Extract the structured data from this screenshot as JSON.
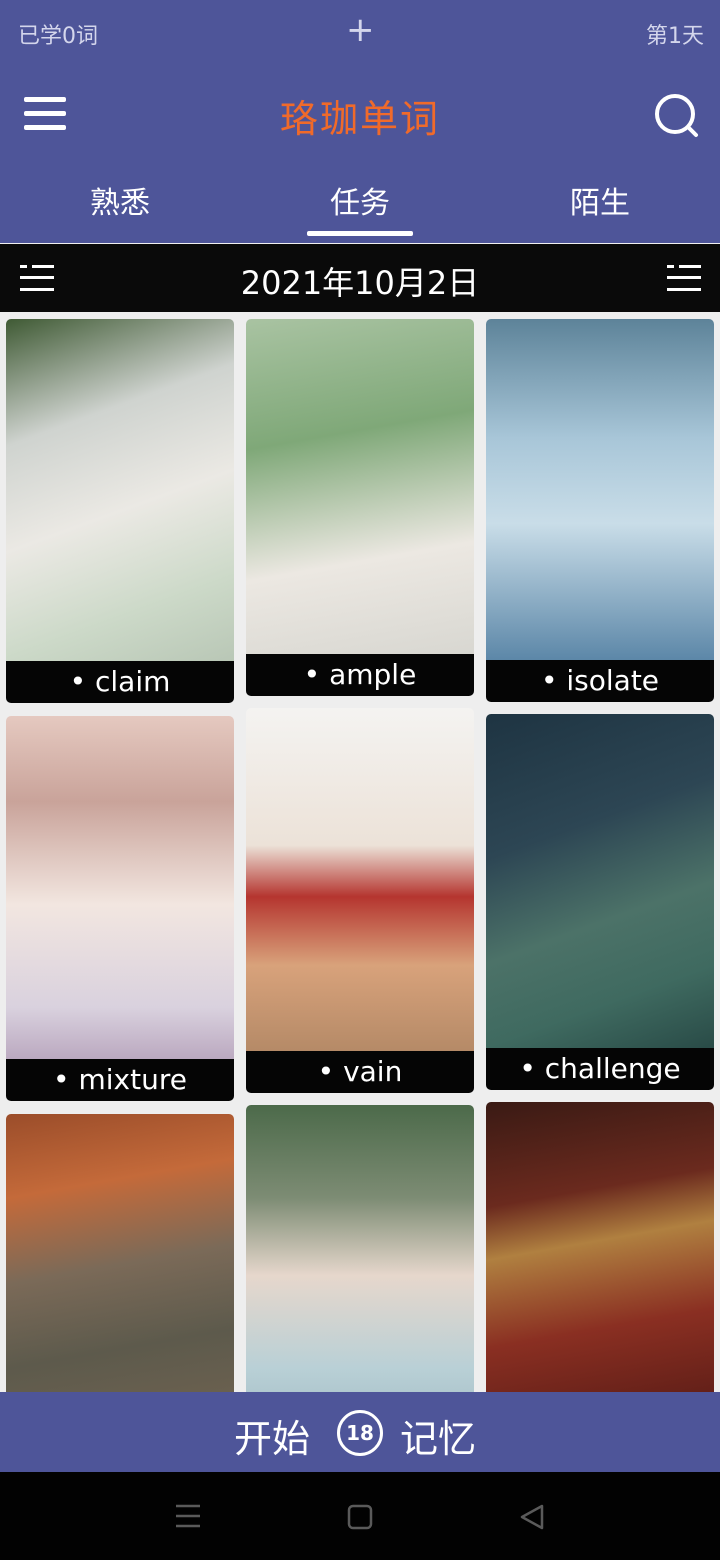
{
  "status": {
    "learned": "已学0词",
    "plus": "+",
    "day": "第1天"
  },
  "header": {
    "title": "珞珈单词"
  },
  "tabs": [
    {
      "label": "熟悉"
    },
    {
      "label": "任务",
      "active": true
    },
    {
      "label": "陌生"
    }
  ],
  "date_bar": {
    "date": "2021年10月2日"
  },
  "cards": [
    {
      "word": "• claim"
    },
    {
      "word": "• ample"
    },
    {
      "word": "• isolate"
    },
    {
      "word": "• mixture"
    },
    {
      "word": "• vain"
    },
    {
      "word": "• challenge"
    },
    {
      "word": ""
    },
    {
      "word": ""
    },
    {
      "word": ""
    }
  ],
  "bottom": {
    "start": "开始",
    "count": "18",
    "memory": "记忆"
  },
  "colors": {
    "header_bg": "#4e5599",
    "title_accent": "#f06a2a",
    "date_bar_bg": "#0a0a0a"
  },
  "icons": [
    "menu-icon",
    "search-icon",
    "list-icon",
    "square-icon",
    "back-triangle-icon"
  ]
}
